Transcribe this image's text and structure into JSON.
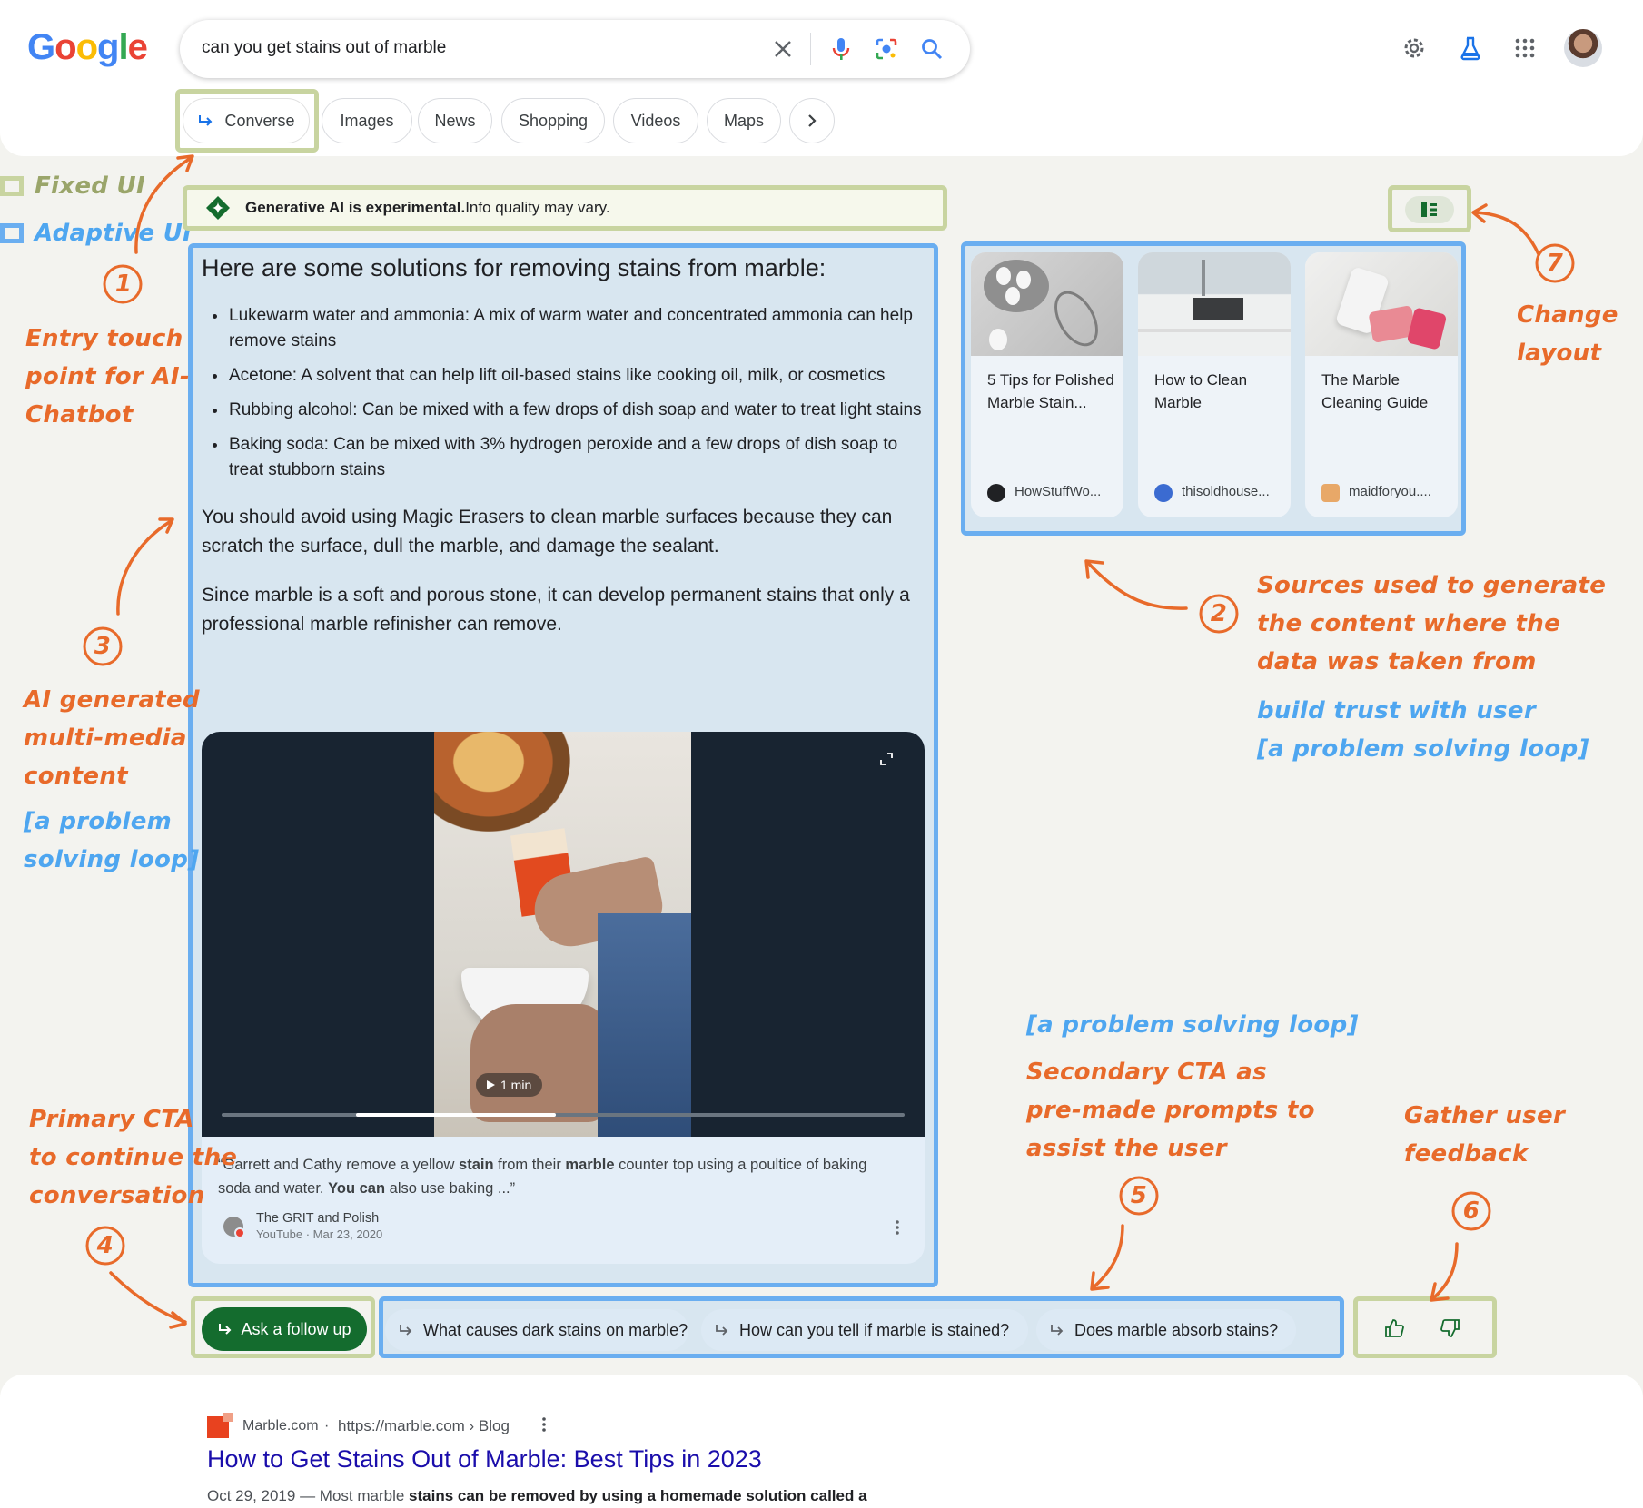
{
  "search": {
    "query": "can you get stains out of marble",
    "logo": [
      "G",
      "o",
      "o",
      "g",
      "l",
      "e"
    ]
  },
  "nav": {
    "tabs": [
      "Converse",
      "Images",
      "News",
      "Shopping",
      "Videos",
      "Maps"
    ]
  },
  "legend": {
    "fixed": "Fixed UI",
    "adaptive": "Adaptive UI"
  },
  "banner": {
    "bold": "Generative AI is experimental.",
    "rest": " Info quality may vary."
  },
  "answer": {
    "heading": "Here are some solutions for removing stains from marble:",
    "bullets": [
      "Lukewarm water and ammonia: A mix of warm water and concentrated ammonia can help remove stains",
      "Acetone: A solvent that can help lift oil-based stains like cooking oil, milk, or cosmetics",
      "Rubbing alcohol: Can be mixed with a few drops of dish soap and water to treat light stains",
      "Baking soda: Can be mixed with 3% hydrogen peroxide and a few drops of dish soap to treat stubborn stains"
    ],
    "para1": "You should avoid using Magic Erasers to clean marble surfaces because they can scratch the surface, dull the marble, and damage the sealant.",
    "para2": "Since marble is a soft and porous stone, it can develop permanent stains that only a professional marble refinisher can remove."
  },
  "video": {
    "duration": "1 min",
    "progress": 0.49,
    "quote_parts": [
      "“Garrett and Cathy remove a yellow ",
      "stain",
      " from their ",
      "marble",
      " counter top using a poultice of baking soda and water. ",
      "You can",
      " also use baking ...”"
    ],
    "channel": "The GRIT and Polish",
    "meta": "YouTube · Mar 23, 2020"
  },
  "sources": [
    {
      "title": "5 Tips for Polished Marble Stain...",
      "site": "HowStuffWo..."
    },
    {
      "title": "How to Clean Marble",
      "site": "thisoldhouse..."
    },
    {
      "title": "The Marble Cleaning Guide",
      "site": "maidforyou...."
    }
  ],
  "followup": {
    "label": "Ask a follow up",
    "prompts": [
      "What causes dark stains on marble?",
      "How can you tell if marble is stained?",
      "Does marble absorb stains?"
    ]
  },
  "result": {
    "site": "Marble.com",
    "url": "https://marble.com › Blog",
    "title": "How to Get Stains Out of Marble: Best Tips in 2023",
    "date": "Oct 29, 2019",
    "snippet_parts": [
      " — Most marble ",
      "stains can be removed by using a homemade solution called a"
    ]
  },
  "annotations": {
    "n1": "1",
    "a1": [
      "Entry touch",
      "point for AI-",
      "Chatbot"
    ],
    "n3": "3",
    "a3": [
      "AI generated",
      "multi-media",
      "content"
    ],
    "a3_loop": [
      "[a problem",
      "solving loop]"
    ],
    "n4": "4",
    "a4": [
      "Primary CTA",
      "to continue the",
      "conversation"
    ],
    "n2": "2",
    "a2": [
      "Sources used to generate",
      "the content where the",
      "data was taken from"
    ],
    "a2_trust": [
      "build trust with user",
      "[a problem solving loop]"
    ],
    "n5": "5",
    "a5_loop": "[a problem solving loop]",
    "a5": [
      "Secondary CTA as",
      "pre-made prompts to",
      "assist the user"
    ],
    "n6": "6",
    "a6": [
      "Gather user",
      "feedback"
    ],
    "n7": "7",
    "a7": [
      "Change",
      "layout"
    ]
  },
  "colors": {
    "accent_orange": "#e86a2a",
    "adaptive_blue": "#6aaef0",
    "fixed_green": "#c8d4a0",
    "cta_green": "#146c2e",
    "link_blue": "#1a0dab"
  }
}
